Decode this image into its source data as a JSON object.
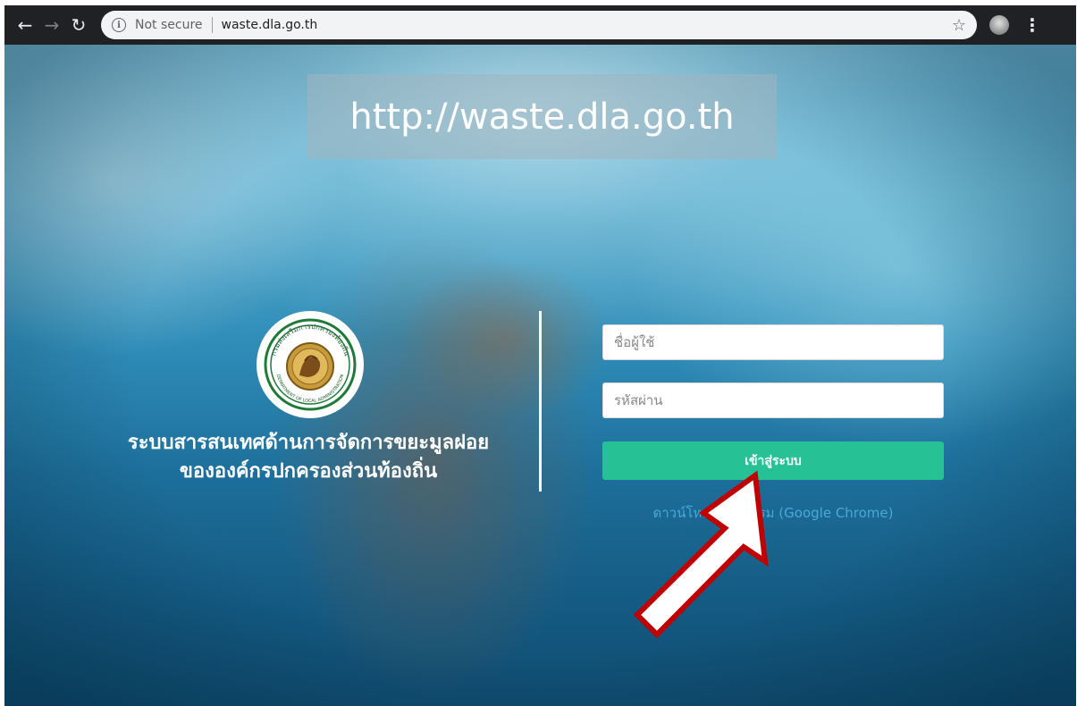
{
  "browser": {
    "back_icon": "arrow-left-icon",
    "forward_icon": "arrow-right-icon",
    "reload_icon": "reload-icon",
    "security_label": "Not secure",
    "url": "waste.dla.go.th",
    "bookmark_icon": "star-icon",
    "menu_icon": "kebab-menu-icon"
  },
  "banner": {
    "text": "http://waste.dla.go.th"
  },
  "logo": {
    "arc_text": "กรมส่งเสริมการปกครองท้องถิ่น",
    "bottom_text": "DEPARTMENT OF LOCAL ADMINISTRATION"
  },
  "system_title": {
    "line1": "ระบบสารสนเทศด้านการจัดการขยะมูลฝอย",
    "line2": "ขององค์กรปกครองส่วนท้องถิ่น"
  },
  "login": {
    "username_placeholder": "ชื่อผู้ใช้",
    "password_placeholder": "รหัสผ่าน",
    "submit_label": "เข้าสู่ระบบ",
    "download_link": "ดาวน์โหลดโปรแกรม (Google Chrome)"
  },
  "colors": {
    "browser_bar": "#202124",
    "login_button": "#26c195",
    "download_link": "#4aa9d6",
    "arrow_border": "#c00000"
  }
}
